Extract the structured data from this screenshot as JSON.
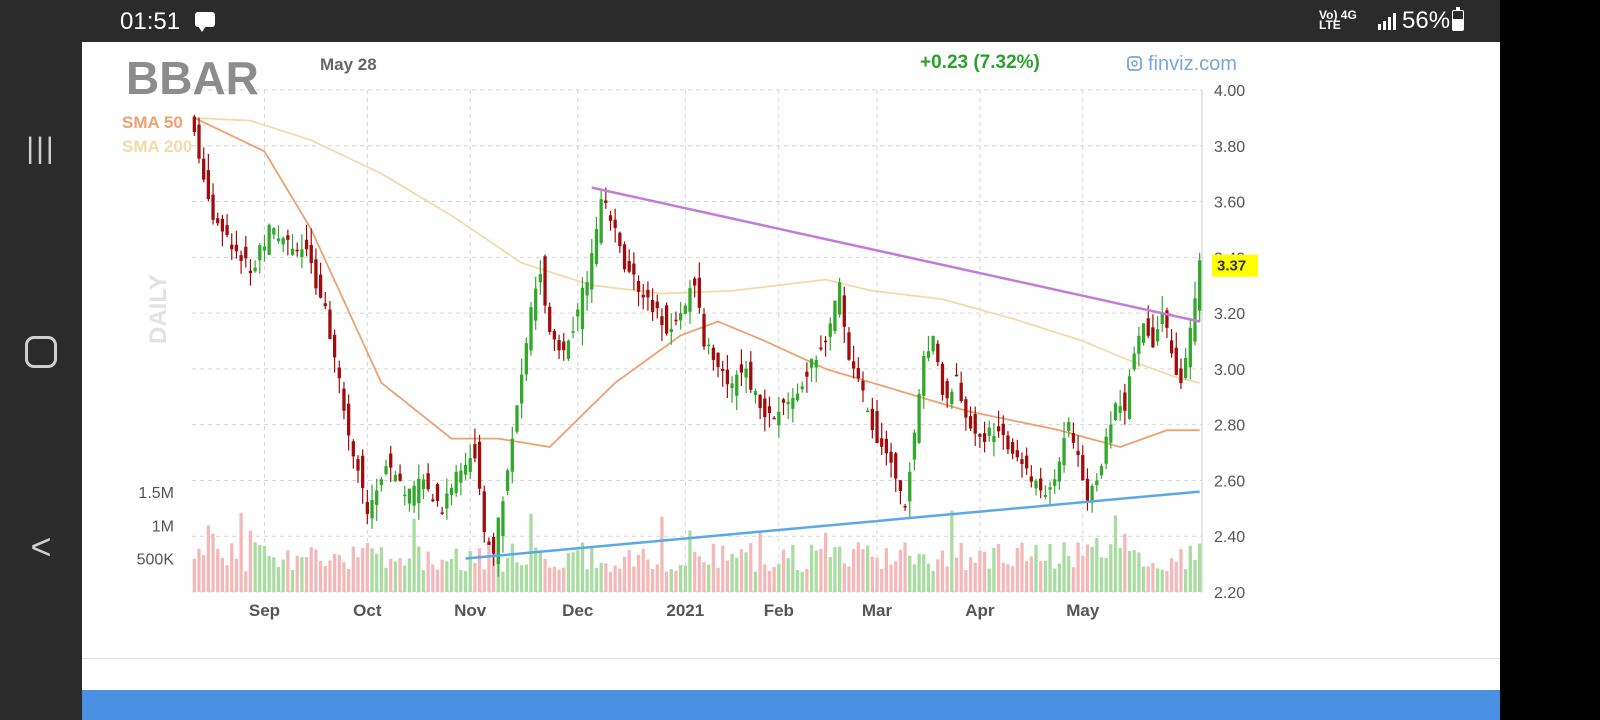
{
  "status_bar": {
    "time": "01:51",
    "network": "Vo) 4G",
    "network_sub": "LTE",
    "battery": "56%",
    "battery_level": 0.56
  },
  "nav_bar": {
    "recents_icon": "|||",
    "home_icon": "O",
    "back_icon": "<"
  },
  "chart_data": {
    "type": "candlestick",
    "ticker": "BBAR",
    "date": "May 28",
    "change": "+0.23 (7.32%)",
    "source": "finviz.com",
    "timeframe_label": "DAILY",
    "legend": [
      {
        "name": "SMA 50",
        "color": "#f0a070"
      },
      {
        "name": "SMA 200",
        "color": "#f5d9a8"
      }
    ],
    "last_price": 3.37,
    "last_price_label": "3.37",
    "colors": {
      "up": "#31a82c",
      "down": "#a10b0b",
      "change": "#2ca02c",
      "source": "#7aa6d9",
      "ticker": "#8c8c8c",
      "trend_upper": "#c27bd6",
      "trend_lower": "#5aa9e6",
      "vol_up": "#a8dca0",
      "vol_down": "#f5b8b8",
      "price_tag": "#ffff00"
    },
    "y_axis": {
      "ylim": [
        2.2,
        4.0
      ],
      "ticks": [
        2.2,
        2.4,
        2.6,
        2.8,
        3.0,
        3.2,
        3.4,
        3.6,
        3.8,
        4.0
      ],
      "tick_labels": [
        "2.20",
        "2.40",
        "2.60",
        "2.80",
        "3.00",
        "3.20",
        "3.40",
        "3.60",
        "3.80",
        "4.00"
      ]
    },
    "volume_axis": {
      "ticks": [
        500000,
        1000000,
        1500000
      ],
      "tick_labels": [
        "500K",
        "1M",
        "1.5M"
      ]
    },
    "x_axis": {
      "ticks": [
        15,
        37,
        59,
        82,
        105,
        125,
        146,
        168,
        190
      ],
      "tick_labels": [
        "Sep",
        "Oct",
        "Nov",
        "Dec",
        "2021",
        "Feb",
        "Mar",
        "Apr",
        "May"
      ]
    },
    "n_bars": 216,
    "close_anchors": [
      [
        0,
        3.85
      ],
      [
        4,
        3.55
      ],
      [
        8,
        3.45
      ],
      [
        12,
        3.35
      ],
      [
        16,
        3.5
      ],
      [
        20,
        3.45
      ],
      [
        24,
        3.42
      ],
      [
        28,
        3.2
      ],
      [
        31,
        2.95
      ],
      [
        34,
        2.7
      ],
      [
        37,
        2.5
      ],
      [
        41,
        2.65
      ],
      [
        45,
        2.55
      ],
      [
        49,
        2.6
      ],
      [
        53,
        2.5
      ],
      [
        57,
        2.65
      ],
      [
        60,
        2.7
      ],
      [
        62,
        2.4
      ],
      [
        64,
        2.35
      ],
      [
        66,
        2.55
      ],
      [
        69,
        2.85
      ],
      [
        72,
        3.2
      ],
      [
        74,
        3.35
      ],
      [
        76,
        3.15
      ],
      [
        79,
        3.05
      ],
      [
        82,
        3.2
      ],
      [
        85,
        3.4
      ],
      [
        87,
        3.6
      ],
      [
        89,
        3.55
      ],
      [
        92,
        3.35
      ],
      [
        95,
        3.3
      ],
      [
        98,
        3.22
      ],
      [
        101,
        3.15
      ],
      [
        104,
        3.2
      ],
      [
        107,
        3.3
      ],
      [
        109,
        3.1
      ],
      [
        112,
        3.0
      ],
      [
        115,
        2.95
      ],
      [
        118,
        3.0
      ],
      [
        121,
        2.85
      ],
      [
        124,
        2.8
      ],
      [
        127,
        2.9
      ],
      [
        130,
        2.95
      ],
      [
        133,
        3.05
      ],
      [
        136,
        3.15
      ],
      [
        138,
        3.3
      ],
      [
        140,
        3.05
      ],
      [
        143,
        2.9
      ],
      [
        146,
        2.75
      ],
      [
        149,
        2.65
      ],
      [
        152,
        2.5
      ],
      [
        154,
        2.75
      ],
      [
        156,
        3.05
      ],
      [
        158,
        3.1
      ],
      [
        160,
        2.9
      ],
      [
        163,
        2.95
      ],
      [
        166,
        2.8
      ],
      [
        169,
        2.75
      ],
      [
        172,
        2.8
      ],
      [
        175,
        2.7
      ],
      [
        178,
        2.65
      ],
      [
        181,
        2.55
      ],
      [
        184,
        2.6
      ],
      [
        187,
        2.8
      ],
      [
        189,
        2.7
      ],
      [
        191,
        2.55
      ],
      [
        193,
        2.6
      ],
      [
        195,
        2.75
      ],
      [
        197,
        2.9
      ],
      [
        199,
        2.85
      ],
      [
        201,
        3.05
      ],
      [
        203,
        3.15
      ],
      [
        205,
        3.1
      ],
      [
        207,
        3.2
      ],
      [
        209,
        3.05
      ],
      [
        211,
        2.95
      ],
      [
        213,
        3.13
      ],
      [
        215,
        3.37
      ]
    ],
    "sma50_anchors": [
      [
        0,
        3.9
      ],
      [
        15,
        3.78
      ],
      [
        25,
        3.5
      ],
      [
        40,
        2.95
      ],
      [
        55,
        2.75
      ],
      [
        65,
        2.75
      ],
      [
        76,
        2.72
      ],
      [
        90,
        2.95
      ],
      [
        104,
        3.12
      ],
      [
        112,
        3.17
      ],
      [
        122,
        3.1
      ],
      [
        135,
        3.0
      ],
      [
        145,
        2.95
      ],
      [
        165,
        2.85
      ],
      [
        185,
        2.78
      ],
      [
        198,
        2.72
      ],
      [
        208,
        2.78
      ],
      [
        215,
        2.78
      ]
    ],
    "sma200_anchors": [
      [
        0,
        3.9
      ],
      [
        12,
        3.89
      ],
      [
        25,
        3.82
      ],
      [
        40,
        3.7
      ],
      [
        55,
        3.55
      ],
      [
        70,
        3.38
      ],
      [
        85,
        3.3
      ],
      [
        100,
        3.27
      ],
      [
        115,
        3.28
      ],
      [
        125,
        3.3
      ],
      [
        135,
        3.32
      ],
      [
        145,
        3.28
      ],
      [
        160,
        3.25
      ],
      [
        175,
        3.18
      ],
      [
        190,
        3.1
      ],
      [
        200,
        3.03
      ],
      [
        210,
        2.97
      ],
      [
        215,
        2.95
      ]
    ],
    "trendlines": [
      {
        "name": "upper",
        "from": [
          85,
          3.65
        ],
        "to": [
          215,
          3.17
        ]
      },
      {
        "name": "lower",
        "from": [
          58,
          2.32
        ],
        "to": [
          215,
          2.56
        ]
      }
    ]
  }
}
